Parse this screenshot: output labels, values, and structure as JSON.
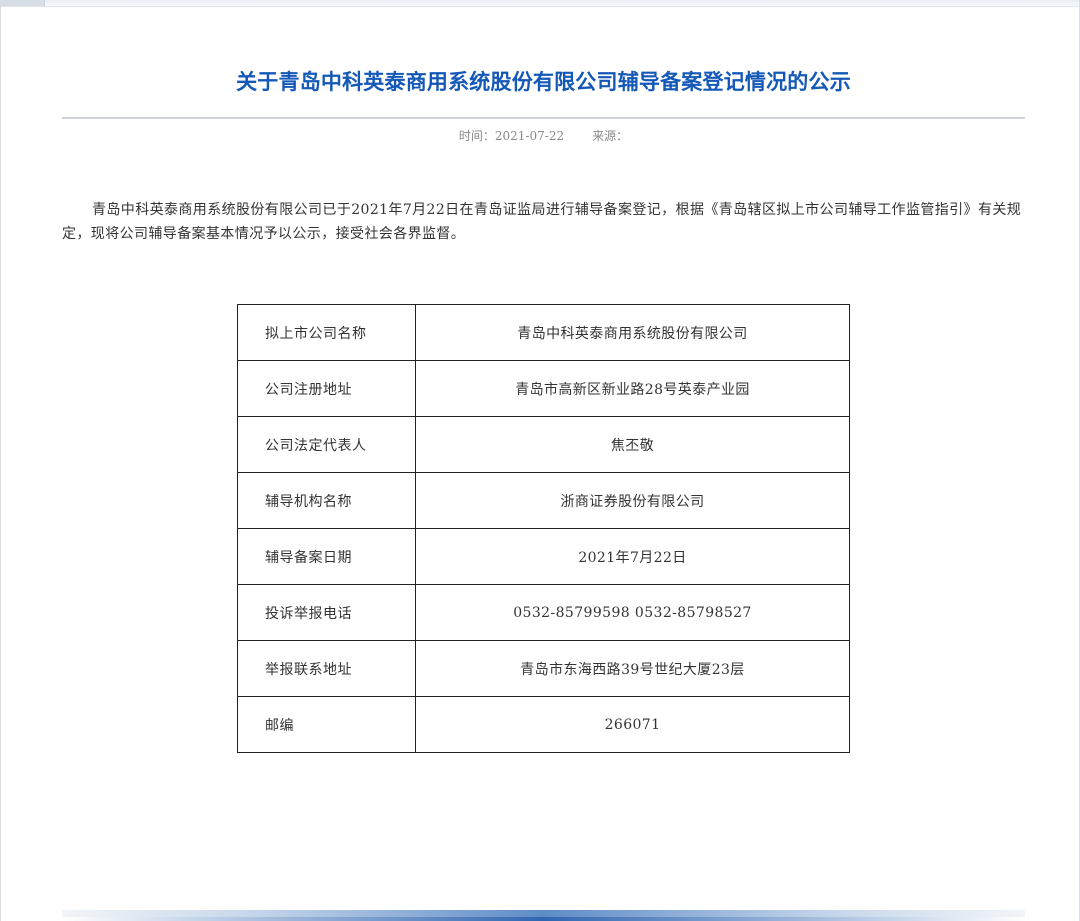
{
  "article": {
    "title": "关于青岛中科英泰商用系统股份有限公司辅导备案登记情况的公示",
    "meta": {
      "time_label": "时间：",
      "time_value": "2021-07-22",
      "source_label": "来源："
    },
    "paragraph": "青岛中科英泰商用系统股份有限公司已于2021年7月22日在青岛证监局进行辅导备案登记，根据《青岛辖区拟上市公司辅导工作监管指引》有关规定，现将公司辅导备案基本情况予以公示，接受社会各界监督。"
  },
  "info_table": {
    "rows": [
      {
        "label": "拟上市公司名称",
        "value": "青岛中科英泰商用系统股份有限公司"
      },
      {
        "label": "公司注册地址",
        "value": "青岛市高新区新业路28号英泰产业园"
      },
      {
        "label": "公司法定代表人",
        "value": "焦丕敬"
      },
      {
        "label": "辅导机构名称",
        "value": "浙商证券股份有限公司"
      },
      {
        "label": "辅导备案日期",
        "value": "2021年7月22日"
      },
      {
        "label": "投诉举报电话",
        "value": "0532-85799598 0532-85798527"
      },
      {
        "label": "举报联系地址",
        "value": "青岛市东海西路39号世纪大厦23层"
      },
      {
        "label": "邮编",
        "value": "266071"
      }
    ]
  },
  "colors": {
    "title": "#1458b8",
    "text": "#333333",
    "meta": "#8a8a8a",
    "border": "#222222"
  }
}
